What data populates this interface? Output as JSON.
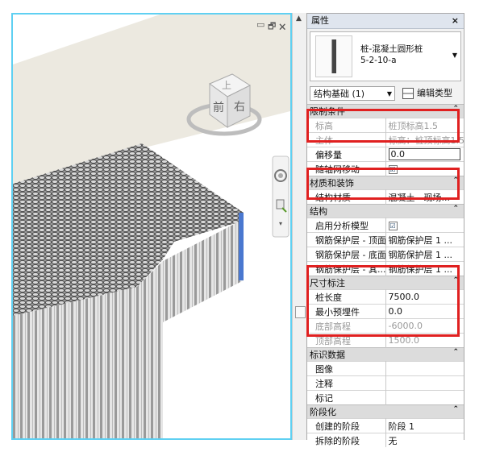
{
  "viewport": {
    "window_controls": [
      "▭",
      "🗗",
      "🗙"
    ],
    "viewcube": {
      "top": "上",
      "front": "前",
      "right": "右"
    }
  },
  "properties": {
    "title": "属性",
    "close": "×",
    "type_name_line1": "桩-混凝土圆形桩",
    "type_name_line2": "5-2-10-a",
    "selector": "结构基础 (1)",
    "edit_type": "编辑类型",
    "categories": [
      {
        "label": "限制条件",
        "rows": [
          {
            "key": "标高",
            "value": "桩顶标高1.5",
            "dim": true
          },
          {
            "key": "主体",
            "value": "标高：桩顶标高1.5",
            "dim": true
          },
          {
            "key": "偏移量",
            "value": "0.0",
            "edit": true
          },
          {
            "key": "随轴网移动",
            "value": "☑",
            "check": true
          }
        ]
      },
      {
        "label": "材质和装饰",
        "rows": [
          {
            "key": "结构材质",
            "value": "混凝土 - 现场..."
          }
        ]
      },
      {
        "label": "结构",
        "rows": [
          {
            "key": "启用分析模型",
            "value": "☑",
            "check": true
          },
          {
            "key": "钢筋保护层 - 顶面",
            "value": "钢筋保护层 1 ..."
          },
          {
            "key": "钢筋保护层 - 底面",
            "value": "钢筋保护层 1 ..."
          },
          {
            "key": "钢筋保护层 - 其...",
            "value": "钢筋保护层 1 ..."
          }
        ]
      },
      {
        "label": "尺寸标注",
        "rows": [
          {
            "key": "桩长度",
            "value": "7500.0"
          },
          {
            "key": "最小预埋件",
            "value": "0.0"
          },
          {
            "key": "底部高程",
            "value": "-6000.0",
            "dim": true
          },
          {
            "key": "顶部高程",
            "value": "1500.0",
            "dim": true
          }
        ]
      },
      {
        "label": "标识数据",
        "rows": [
          {
            "key": "图像",
            "value": ""
          },
          {
            "key": "注释",
            "value": ""
          },
          {
            "key": "标记",
            "value": ""
          }
        ]
      },
      {
        "label": "阶段化",
        "rows": [
          {
            "key": "创建的阶段",
            "value": "阶段 1"
          },
          {
            "key": "拆除的阶段",
            "value": "无"
          }
        ]
      }
    ]
  }
}
